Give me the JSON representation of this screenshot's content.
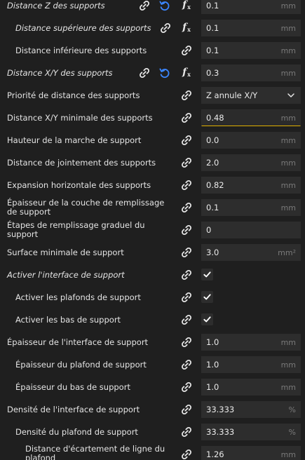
{
  "colors": {
    "background": "#1f1f1f",
    "field": "#2d2d2d",
    "reset_blue": "#3b86ff",
    "active_border": "#e0b000",
    "unit": "#7a7a7a"
  },
  "rows": [
    {
      "label": "Distance Z des supports",
      "italic": true,
      "indent": 10,
      "value": "0.1",
      "unit": "mm",
      "reset": true,
      "fx": true,
      "type": "input"
    },
    {
      "label": "Distance supérieure des supports",
      "italic": true,
      "indent": 22,
      "value": "0.1",
      "unit": "mm",
      "reset": false,
      "fx": true,
      "type": "input"
    },
    {
      "label": "Distance inférieure des supports",
      "italic": false,
      "indent": 22,
      "value": "0.1",
      "unit": "mm",
      "type": "input"
    },
    {
      "label": "Distance X/Y des supports",
      "italic": true,
      "indent": 10,
      "value": "0.3",
      "unit": "mm",
      "reset": true,
      "fx": true,
      "type": "input"
    },
    {
      "label": "Priorité de distance des supports",
      "italic": false,
      "indent": 10,
      "value": "Z annule X/Y",
      "type": "combo",
      "icon_chevron": "chevron-down-icon"
    },
    {
      "label": "Distance X/Y minimale des supports",
      "italic": false,
      "indent": 10,
      "value": "0.48",
      "unit": "mm",
      "type": "input",
      "active": true
    },
    {
      "label": "Hauteur de la marche de support",
      "italic": false,
      "indent": 10,
      "value": "0.0",
      "unit": "mm",
      "type": "input"
    },
    {
      "label": "Distance de jointement des supports",
      "italic": false,
      "indent": 10,
      "value": "2.0",
      "unit": "mm",
      "type": "input"
    },
    {
      "label": "Expansion horizontale des supports",
      "italic": false,
      "indent": 10,
      "value": "0.82",
      "unit": "mm",
      "type": "input"
    },
    {
      "label": "Épaisseur de la couche de remplissage de support",
      "italic": false,
      "indent": 10,
      "value": "0.1",
      "unit": "mm",
      "type": "input",
      "wrap": true
    },
    {
      "label": "Étapes de remplissage graduel du support",
      "italic": false,
      "indent": 10,
      "value": "0",
      "unit": "",
      "type": "input"
    },
    {
      "label": "Surface minimale de support",
      "italic": false,
      "indent": 10,
      "value": "3.0",
      "unit": "mm²",
      "type": "input"
    },
    {
      "label": "Activer l'interface de support",
      "italic": true,
      "indent": 10,
      "checked": true,
      "type": "checkbox"
    },
    {
      "label": "Activer les plafonds de support",
      "italic": false,
      "indent": 22,
      "checked": true,
      "type": "checkbox"
    },
    {
      "label": "Activer les bas de support",
      "italic": false,
      "indent": 22,
      "checked": true,
      "type": "checkbox"
    },
    {
      "label": "Épaisseur de l'interface de support",
      "italic": false,
      "indent": 10,
      "value": "1.0",
      "unit": "mm",
      "type": "input"
    },
    {
      "label": "Épaisseur du plafond de support",
      "italic": false,
      "indent": 22,
      "value": "1.0",
      "unit": "mm",
      "type": "input"
    },
    {
      "label": "Épaisseur du bas de support",
      "italic": false,
      "indent": 22,
      "value": "1.0",
      "unit": "mm",
      "type": "input"
    },
    {
      "label": "Densité de l'interface de support",
      "italic": false,
      "indent": 10,
      "value": "33.333",
      "unit": "%",
      "type": "input"
    },
    {
      "label": "Densité du plafond de support",
      "italic": false,
      "indent": 22,
      "value": "33.333",
      "unit": "%",
      "type": "input"
    },
    {
      "label": "Distance d'écartement de ligne du plafond",
      "italic": false,
      "indent": 36,
      "value": "1.26",
      "unit": "mm",
      "type": "input",
      "clipped": true
    }
  ]
}
